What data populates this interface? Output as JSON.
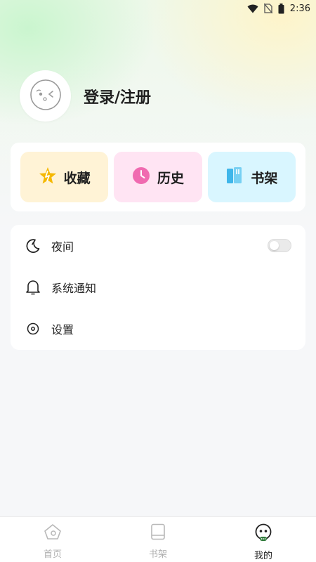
{
  "status_bar": {
    "time": "2:36"
  },
  "profile": {
    "login_label": "登录/注册"
  },
  "quick_actions": [
    {
      "label": "收藏",
      "icon": "star-icon",
      "color": "#f5b800"
    },
    {
      "label": "历史",
      "icon": "clock-icon",
      "color": "#f06ab0"
    },
    {
      "label": "书架",
      "icon": "bookshelf-icon",
      "color": "#3fb6ea"
    }
  ],
  "menu": {
    "night_label": "夜间",
    "night_enabled": false,
    "notify_label": "系统通知",
    "settings_label": "设置"
  },
  "tabbar": {
    "items": [
      {
        "label": "首页",
        "icon": "home-icon",
        "active": false
      },
      {
        "label": "书架",
        "icon": "book-icon",
        "active": false
      },
      {
        "label": "我的",
        "icon": "profile-face-icon",
        "active": true
      }
    ]
  },
  "colors": {
    "accent_green": "#2f7a3a",
    "inactive": "#b0b0b0"
  }
}
